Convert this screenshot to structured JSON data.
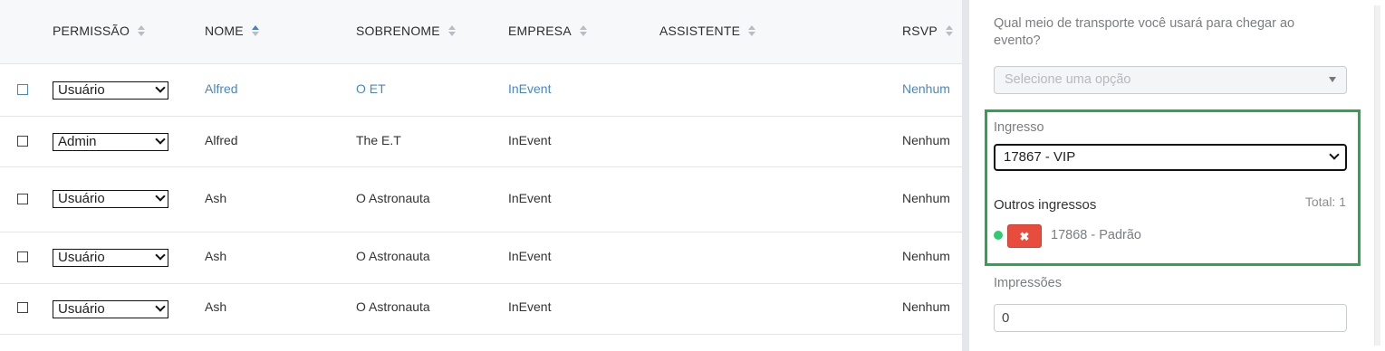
{
  "table": {
    "headers": {
      "permissao": "PERMISSÃO",
      "nome": "NOME",
      "sobrenome": "SOBRENOME",
      "empresa": "EMPRESA",
      "assistente": "ASSISTENTE",
      "rsvp": "RSVP"
    },
    "rows": [
      {
        "permissao": "Usuário",
        "nome": "Alfred",
        "sobrenome": "O ET",
        "empresa": "InEvent",
        "assistente": "",
        "rsvp": "Nenhum"
      },
      {
        "permissao": "Admin",
        "nome": "Alfred",
        "sobrenome": "The E.T",
        "empresa": "InEvent",
        "assistente": "",
        "rsvp": "Nenhum"
      },
      {
        "permissao": "Usuário",
        "nome": "Ash",
        "sobrenome": "O Astronauta",
        "empresa": "InEvent",
        "assistente": "",
        "rsvp": "Nenhum"
      },
      {
        "permissao": "Usuário",
        "nome": "Ash",
        "sobrenome": "O Astronauta",
        "empresa": "InEvent",
        "assistente": "",
        "rsvp": "Nenhum"
      },
      {
        "permissao": "Usuário",
        "nome": "Ash",
        "sobrenome": "O Astronauta",
        "empresa": "InEvent",
        "assistente": "",
        "rsvp": "Nenhum"
      }
    ]
  },
  "panel": {
    "transport_question": "Qual meio de transporte você usará para chegar ao evento?",
    "transport_placeholder": "Selecione uma opção",
    "ticket_label": "Ingresso",
    "ticket_value": "17867 - VIP",
    "other_tickets_label": "Outros ingressos",
    "total_label": "Total: 1",
    "remove_button": "✖",
    "other_ticket_item": "17868 - Padrão",
    "impressions_label": "Impressões",
    "impressions_value": "0"
  },
  "colors": {
    "link_blue": "#4a86c5",
    "highlight_green": "#2ea44f",
    "remove_red": "#e74c3c",
    "status_dot_green": "#2ecc71"
  }
}
